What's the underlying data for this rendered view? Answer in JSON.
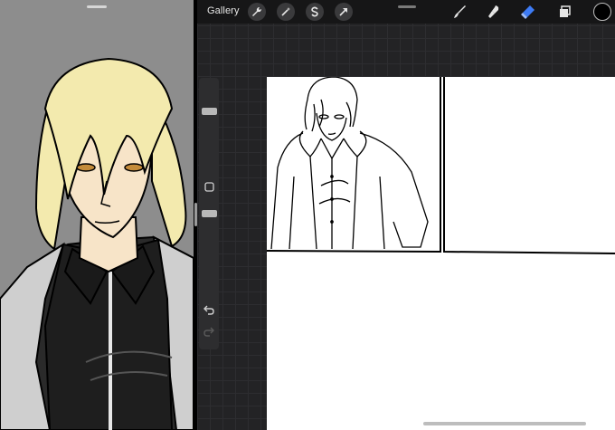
{
  "toolbar": {
    "gallery_label": "Gallery",
    "icons": [
      "wrench-icon",
      "magic-wand-icon",
      "selection-s-icon",
      "transform-arrow-icon",
      "brush-icon",
      "smudge-icon",
      "eraser-icon",
      "layers-icon"
    ],
    "active_tool": "eraser",
    "current_color": "#000000"
  },
  "colors": {
    "ui_dark": "#161617",
    "canvas_bg": "#232325",
    "accent_blue": "#3d7bf5",
    "hair_fill": "#f3eaae",
    "skin_fill": "#f7e4c8"
  }
}
